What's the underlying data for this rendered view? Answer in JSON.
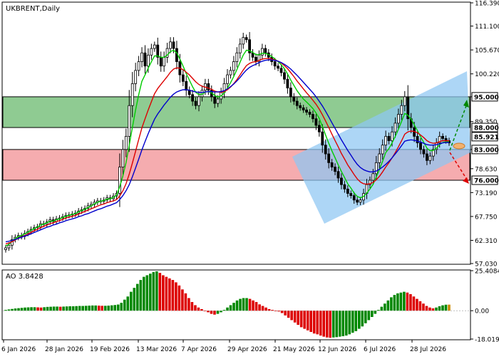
{
  "chart_data": [
    {
      "type": "candlestick",
      "title": "UKBRENT,Daily",
      "ylim": [
        57.03,
        116.39
      ],
      "y_ticks": [
        "116.390",
        "111.100",
        "105.670",
        "100.220",
        "95.000",
        "89.350",
        "83.000",
        "78.630",
        "73.190",
        "67.750",
        "62.310",
        "57.030"
      ],
      "x_ticks": [
        "6 Jan 2026",
        "28 Jan 2026",
        "19 Feb 2026",
        "13 Mar 2026",
        "7 Apr 2026",
        "29 Apr 2026",
        "21 May 2026",
        "12 Jun 2026",
        "6 Jul 2026",
        "28 Jul 2026"
      ],
      "levels": [
        {
          "label": "95.000",
          "value": 95.0
        },
        {
          "label": "88.000",
          "value": 88.0
        },
        {
          "label": "85.921",
          "value": 85.921
        },
        {
          "label": "83.000",
          "value": 83.0
        },
        {
          "label": "76.000",
          "value": 76.0
        }
      ],
      "zones": {
        "resistance": [
          88.0,
          95.0
        ],
        "support": [
          76.0,
          83.0
        ]
      },
      "close_prices": [
        60.6,
        61.2,
        62.5,
        63.0,
        63.4,
        63.2,
        63.9,
        64.3,
        64.8,
        65.2,
        65.4,
        66.1,
        66.0,
        66.5,
        67.0,
        66.6,
        67.2,
        67.4,
        67.7,
        68.0,
        68.1,
        68.3,
        68.5,
        69.0,
        69.3,
        69.6,
        70.2,
        70.5,
        71.0,
        71.3,
        71.2,
        71.5,
        72.0,
        71.8,
        72.4,
        73.0,
        79.0,
        83.0,
        86.0,
        93.0,
        98.0,
        101.0,
        103.0,
        105.0,
        102.0,
        104.5,
        106.0,
        106.8,
        104.0,
        102.0,
        104.0,
        106.0,
        107.5,
        106.0,
        103.0,
        100.0,
        98.5,
        96.5,
        95.5,
        94.0,
        93.0,
        95.0,
        96.5,
        98.0,
        96.5,
        95.0,
        93.5,
        94.5,
        96.0,
        98.0,
        100.0,
        101.0,
        103.0,
        105.0,
        107.0,
        108.5,
        108.0,
        105.0,
        104.0,
        103.0,
        104.5,
        106.0,
        105.0,
        104.0,
        103.0,
        102.0,
        101.5,
        100.5,
        99.0,
        97.0,
        95.0,
        94.0,
        93.0,
        92.5,
        92.0,
        91.5,
        91.0,
        90.0,
        88.5,
        87.0,
        84.0,
        82.0,
        80.0,
        79.0,
        78.0,
        76.5,
        75.0,
        74.0,
        73.0,
        72.5,
        71.5,
        71.0,
        71.5,
        73.0,
        75.0,
        76.0,
        77.5,
        80.0,
        82.0,
        84.0,
        86.0,
        85.0,
        87.0,
        89.0,
        91.0,
        93.0,
        95.0,
        90.0,
        88.0,
        86.0,
        84.5,
        83.0,
        82.0,
        80.5,
        81.5,
        83.0,
        84.5,
        86.0,
        85.5,
        85.0,
        84.5
      ],
      "series": [
        {
          "name": "",
          "color": "#00cc00",
          "values": [
            61.0,
            61.4,
            62.1,
            62.7,
            63.2,
            63.4,
            63.8,
            64.2,
            64.6,
            65.0,
            65.3,
            65.8,
            66.0,
            66.3,
            66.7,
            66.7,
            67.0,
            67.2,
            67.5,
            67.8,
            68.0,
            68.2,
            68.4,
            68.8,
            69.1,
            69.4,
            69.8,
            70.2,
            70.6,
            71.0,
            71.2,
            71.4,
            71.7,
            71.8,
            72.1,
            72.6,
            74.5,
            77.0,
            80.0,
            84.0,
            88.0,
            92.0,
            95.5,
            98.5,
            100.0,
            101.5,
            103.0,
            104.3,
            104.3,
            104.0,
            104.0,
            104.5,
            105.3,
            105.6,
            105.0,
            103.6,
            102.0,
            100.3,
            98.8,
            97.3,
            96.0,
            95.5,
            95.6,
            96.1,
            96.2,
            95.9,
            95.3,
            95.0,
            95.2,
            95.9,
            97.0,
            98.2,
            99.6,
            101.2,
            102.9,
            104.5,
            105.6,
            105.5,
            105.1,
            104.6,
            104.6,
            104.9,
            104.9,
            104.6,
            104.2,
            103.6,
            103.0,
            102.3,
            101.4,
            100.2,
            98.8,
            97.6,
            96.4,
            95.4,
            94.5,
            93.8,
            93.1,
            92.3,
            91.3,
            90.1,
            88.2,
            86.3,
            84.4,
            82.7,
            81.1,
            79.5,
            78.0,
            76.6,
            75.2,
            74.2,
            73.1,
            72.3,
            72.0,
            72.3,
            73.1,
            74.0,
            75.1,
            76.7,
            78.5,
            80.3,
            82.3,
            83.2,
            84.5,
            86.0,
            87.6,
            89.4,
            91.2,
            90.8,
            89.9,
            88.6,
            87.3,
            85.9,
            84.6,
            83.3,
            82.7,
            82.8,
            83.3,
            84.1,
            84.6,
            84.8,
            84.8
          ]
        },
        {
          "name": "",
          "color": "#dd0000",
          "values": [
            61.5,
            61.7,
            62.0,
            62.4,
            62.8,
            63.1,
            63.4,
            63.7,
            64.1,
            64.5,
            64.8,
            65.2,
            65.5,
            65.8,
            66.1,
            66.3,
            66.6,
            66.8,
            67.1,
            67.4,
            67.6,
            67.8,
            68.0,
            68.3,
            68.6,
            68.9,
            69.2,
            69.5,
            69.8,
            70.1,
            70.4,
            70.6,
            70.9,
            71.1,
            71.3,
            71.6,
            72.4,
            73.6,
            75.2,
            77.4,
            79.9,
            82.6,
            85.3,
            87.9,
            90.0,
            92.0,
            93.9,
            95.7,
            96.9,
            97.8,
            98.7,
            99.6,
            100.6,
            101.3,
            101.6,
            101.5,
            101.2,
            100.6,
            100.0,
            99.2,
            98.4,
            97.8,
            97.4,
            97.2,
            97.0,
            96.7,
            96.3,
            96.1,
            96.0,
            96.2,
            96.6,
            97.2,
            98.0,
            98.9,
            100.0,
            101.1,
            102.1,
            102.6,
            102.9,
            103.0,
            103.3,
            103.6,
            103.7,
            103.7,
            103.6,
            103.4,
            103.1,
            102.7,
            102.1,
            101.4,
            100.5,
            99.6,
            98.6,
            97.7,
            96.8,
            95.9,
            95.1,
            94.2,
            93.3,
            92.2,
            90.9,
            89.5,
            88.0,
            86.5,
            85.0,
            83.6,
            82.1,
            80.8,
            79.5,
            78.4,
            77.3,
            76.3,
            75.6,
            75.2,
            75.1,
            75.2,
            75.5,
            76.1,
            76.9,
            77.9,
            79.0,
            80.0,
            81.1,
            82.3,
            83.6,
            85.0,
            86.5,
            87.0,
            87.2,
            87.1,
            86.8,
            86.3,
            85.7,
            85.0,
            84.6,
            84.4,
            84.5,
            84.8,
            85.0,
            85.0,
            85.0
          ]
        },
        {
          "name": "",
          "color": "#0000cc",
          "values": [
            62.0,
            62.1,
            62.3,
            62.5,
            62.8,
            63.0,
            63.3,
            63.5,
            63.8,
            64.1,
            64.4,
            64.7,
            65.0,
            65.3,
            65.5,
            65.8,
            66.0,
            66.3,
            66.5,
            66.8,
            67.0,
            67.2,
            67.4,
            67.7,
            67.9,
            68.2,
            68.4,
            68.7,
            69.0,
            69.3,
            69.5,
            69.8,
            70.1,
            70.3,
            70.6,
            70.9,
            71.6,
            72.5,
            73.6,
            75.0,
            76.8,
            78.8,
            80.8,
            82.9,
            84.8,
            86.6,
            88.3,
            89.9,
            91.1,
            92.1,
            93.1,
            94.0,
            94.9,
            95.6,
            96.1,
            96.4,
            96.6,
            96.6,
            96.5,
            96.3,
            96.1,
            96.0,
            96.0,
            96.1,
            96.2,
            96.2,
            96.1,
            96.1,
            96.2,
            96.4,
            96.8,
            97.3,
            97.9,
            98.6,
            99.4,
            100.3,
            101.1,
            101.7,
            102.1,
            102.4,
            102.8,
            103.1,
            103.3,
            103.4,
            103.4,
            103.3,
            103.1,
            102.8,
            102.4,
            101.9,
            101.3,
            100.6,
            99.9,
            99.1,
            98.3,
            97.5,
            96.7,
            95.9,
            95.0,
            94.0,
            92.9,
            91.7,
            90.4,
            89.1,
            87.8,
            86.5,
            85.2,
            84.0,
            82.8,
            81.7,
            80.6,
            79.6,
            78.9,
            78.4,
            78.1,
            77.9,
            77.9,
            78.1,
            78.5,
            79.0,
            79.6,
            80.3,
            81.1,
            82.0,
            82.9,
            83.9,
            84.9,
            85.1,
            85.2,
            85.1,
            84.9,
            84.7,
            84.4,
            84.1,
            84.0,
            84.0,
            84.1,
            84.3,
            84.5,
            84.6,
            84.6
          ]
        }
      ]
    },
    {
      "type": "bar",
      "title": "AO 3.8428",
      "ylim": [
        -18.0198,
        25.4084
      ],
      "y_ticks": [
        "25.4084",
        "0.00",
        "-18.0198"
      ],
      "values": [
        0.5,
        0.8,
        1.1,
        1.4,
        1.6,
        1.8,
        2.0,
        2.1,
        2.2,
        2.2,
        2.1,
        2.0,
        2.2,
        2.4,
        2.5,
        2.6,
        2.6,
        2.5,
        2.6,
        2.7,
        2.8,
        2.8,
        2.9,
        3.0,
        3.0,
        3.1,
        3.2,
        3.3,
        3.3,
        3.2,
        3.1,
        3.1,
        3.2,
        3.4,
        3.6,
        3.9,
        5.0,
        7.0,
        9.0,
        12.0,
        14.5,
        17.0,
        19.5,
        21.5,
        22.5,
        23.5,
        24.5,
        25.0,
        24.0,
        22.5,
        21.5,
        20.5,
        19.5,
        18.0,
        16.0,
        13.5,
        11.0,
        8.0,
        5.5,
        3.5,
        2.0,
        1.0,
        0.0,
        -1.0,
        -2.0,
        -2.5,
        -2.0,
        -1.0,
        0.5,
        2.0,
        3.5,
        5.0,
        6.5,
        7.5,
        8.0,
        8.0,
        7.5,
        6.5,
        5.5,
        4.0,
        3.0,
        2.0,
        1.0,
        0.5,
        0.0,
        -0.5,
        -1.5,
        -3.0,
        -4.5,
        -6.0,
        -7.5,
        -9.0,
        -10.5,
        -11.5,
        -12.5,
        -13.5,
        -14.5,
        -15.0,
        -15.8,
        -16.5,
        -17.0,
        -17.2,
        -17.0,
        -16.8,
        -16.5,
        -16.2,
        -15.8,
        -15.0,
        -14.0,
        -13.0,
        -11.5,
        -10.0,
        -8.0,
        -6.0,
        -4.0,
        -2.0,
        0.5,
        2.5,
        4.5,
        6.5,
        8.5,
        10.0,
        11.0,
        11.5,
        12.0,
        11.5,
        10.5,
        9.0,
        7.5,
        6.0,
        4.5,
        3.0,
        2.0,
        1.5,
        2.0,
        2.8,
        3.4,
        3.8,
        3.84
      ],
      "colors": {
        "up": "#008800",
        "down": "#dd0000",
        "current": "#cc8800"
      }
    }
  ],
  "ui": {
    "bull_color": "#ffffff",
    "bear_color": "#000000",
    "arrow_up_color": "#008800",
    "arrow_down_color": "#dd0000"
  }
}
